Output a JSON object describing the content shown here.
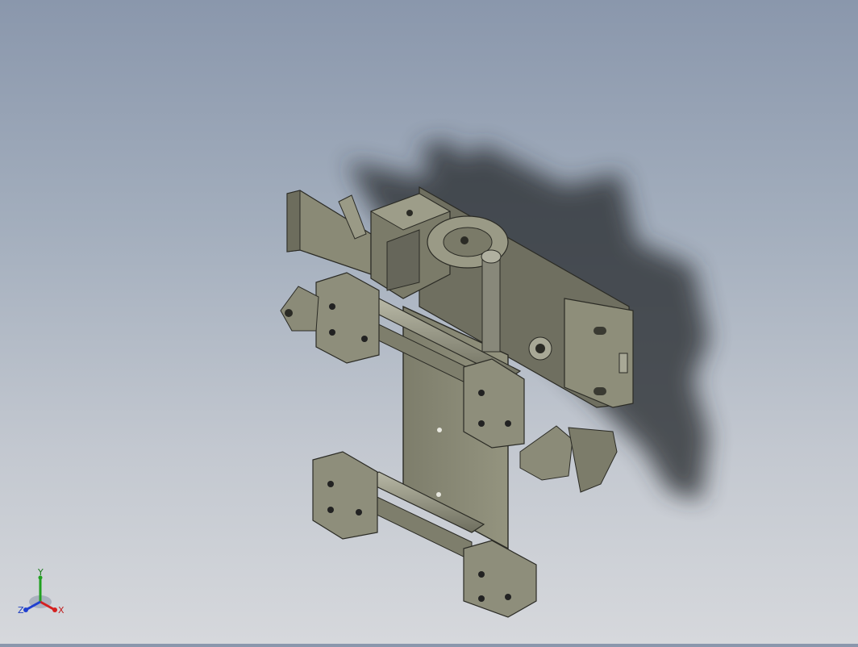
{
  "viewport": {
    "background_top": "#8a97ac",
    "background_bottom": "#d6d8dc",
    "model_color": "#8a8a76",
    "shadow_color": "#2a2d33"
  },
  "triad": {
    "x_label": "X",
    "y_label": "Y",
    "z_label": "Z",
    "x_color": "#d42020",
    "y_color": "#20a020",
    "z_color": "#2040d0"
  }
}
